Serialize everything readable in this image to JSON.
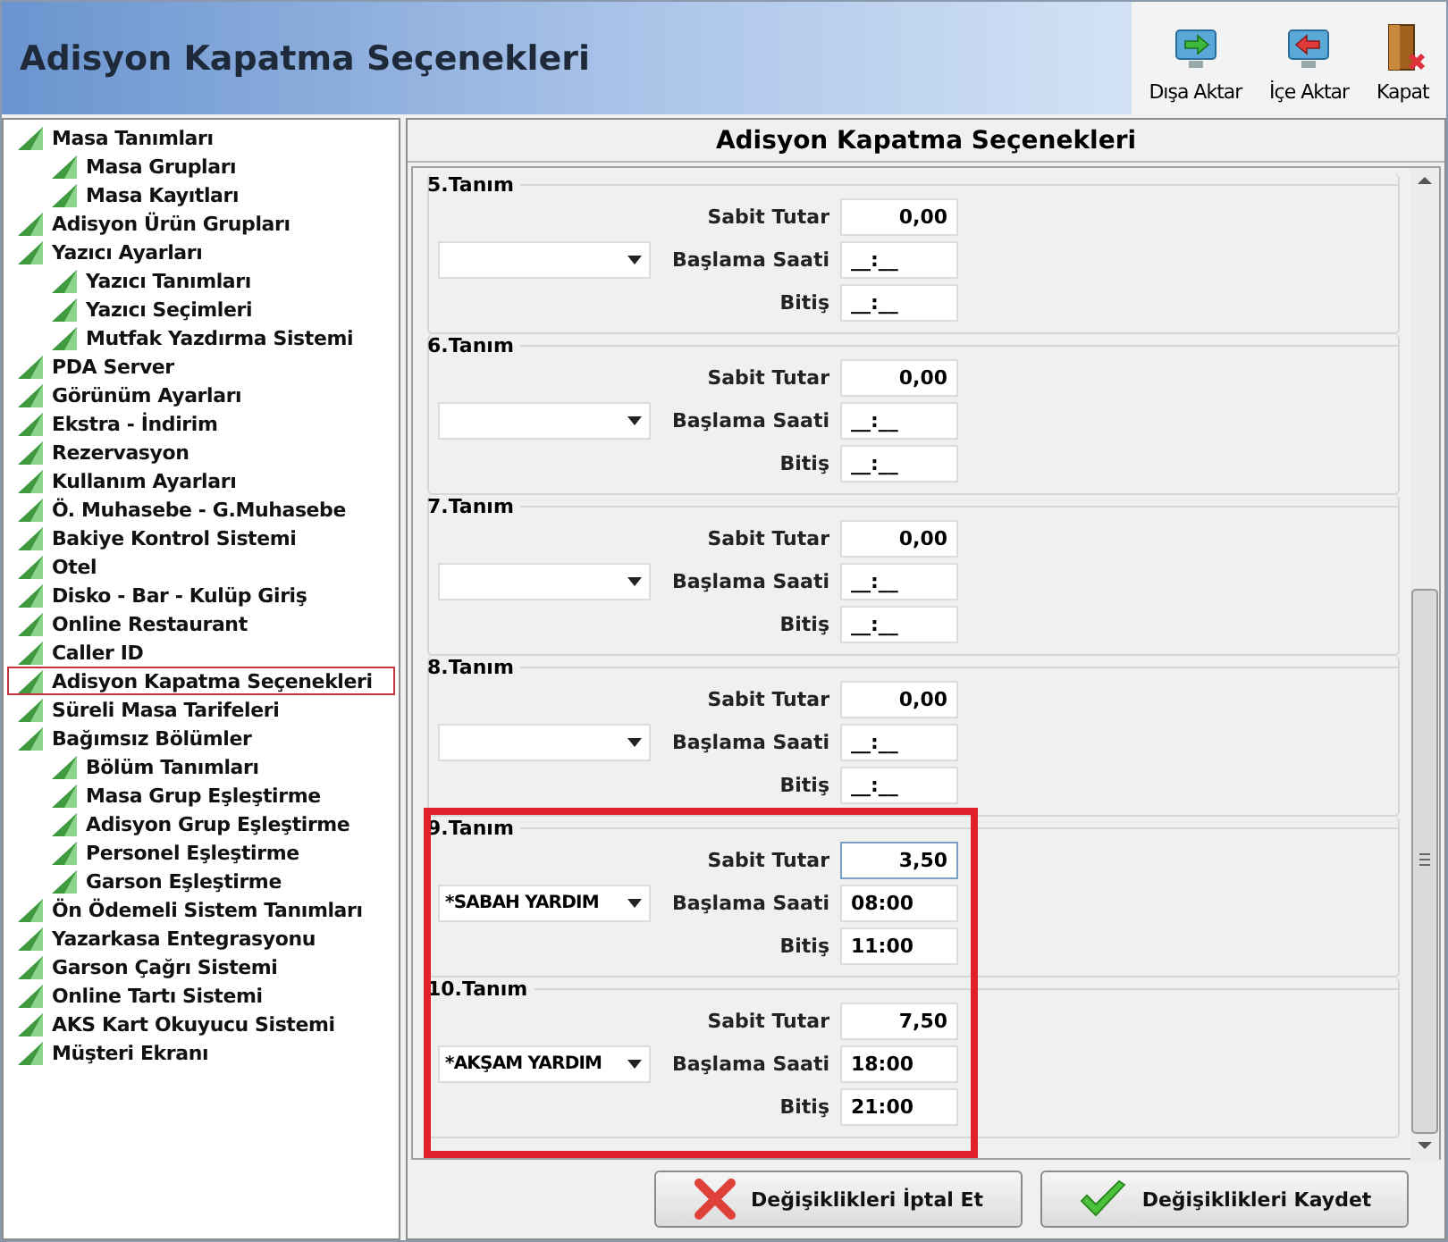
{
  "header": {
    "title": "Adisyon Kapatma Seçenekleri"
  },
  "toolbar": [
    {
      "kind": "export",
      "label": "Dışa Aktar"
    },
    {
      "kind": "import",
      "label": "İçe Aktar"
    },
    {
      "kind": "close",
      "label": "Kapat"
    }
  ],
  "sidebar": {
    "items": [
      {
        "label": "Masa Tanımları",
        "selected": false,
        "children": [
          {
            "label": "Masa Grupları",
            "selected": false
          },
          {
            "label": "Masa Kayıtları",
            "selected": false
          }
        ]
      },
      {
        "label": "Adisyon Ürün Grupları",
        "selected": false
      },
      {
        "label": "Yazıcı Ayarları",
        "selected": false,
        "children": [
          {
            "label": "Yazıcı Tanımları",
            "selected": false
          },
          {
            "label": "Yazıcı Seçimleri",
            "selected": false
          },
          {
            "label": "Mutfak Yazdırma Sistemi",
            "selected": false
          }
        ]
      },
      {
        "label": "PDA Server",
        "selected": false
      },
      {
        "label": "Görünüm Ayarları",
        "selected": false
      },
      {
        "label": "Ekstra - İndirim",
        "selected": false
      },
      {
        "label": "Rezervasyon",
        "selected": false
      },
      {
        "label": "Kullanım Ayarları",
        "selected": false
      },
      {
        "label": "Ö. Muhasebe - G.Muhasebe",
        "selected": false
      },
      {
        "label": "Bakiye Kontrol Sistemi",
        "selected": false
      },
      {
        "label": "Otel",
        "selected": false
      },
      {
        "label": "Disko - Bar - Kulüp Giriş",
        "selected": false
      },
      {
        "label": "Online Restaurant",
        "selected": false
      },
      {
        "label": "Caller ID",
        "selected": false
      },
      {
        "label": "Adisyon Kapatma Seçenekleri",
        "selected": true
      },
      {
        "label": "Süreli Masa Tarifeleri",
        "selected": false
      },
      {
        "label": "Bağımsız Bölümler",
        "selected": false,
        "children": [
          {
            "label": "Bölüm Tanımları",
            "selected": false
          },
          {
            "label": "Masa Grup Eşleştirme",
            "selected": false
          },
          {
            "label": "Adisyon Grup Eşleştirme",
            "selected": false
          },
          {
            "label": "Personel Eşleştirme",
            "selected": false
          },
          {
            "label": "Garson Eşleştirme",
            "selected": false
          }
        ]
      },
      {
        "label": "Ön Ödemeli Sistem Tanımları",
        "selected": false
      },
      {
        "label": "Yazarkasa Entegrasyonu",
        "selected": false
      },
      {
        "label": "Garson Çağrı Sistemi",
        "selected": false
      },
      {
        "label": "Online Tartı Sistemi",
        "selected": false
      },
      {
        "label": "AKS Kart Okuyucu Sistemi",
        "selected": false
      },
      {
        "label": "Müşteri Ekranı",
        "selected": false
      }
    ]
  },
  "panel": {
    "title": "Adisyon Kapatma Seçenekleri",
    "groups": [
      {
        "title": "5.Tanım",
        "highlighted": false,
        "amount_label": "Sabit Tutar",
        "amount": {
          "value": "0,00",
          "focused": false
        },
        "start_label": "Başlama Saati",
        "start": "__:__",
        "end_label": "Bitiş",
        "end": "__:__"
      },
      {
        "title": "6.Tanım",
        "highlighted": false,
        "amount_label": "Sabit Tutar",
        "amount": {
          "value": "0,00",
          "focused": false
        },
        "start_label": "Başlama Saati",
        "start": "__:__",
        "end_label": "Bitiş",
        "end": "__:__"
      },
      {
        "title": "7.Tanım",
        "highlighted": false,
        "amount_label": "Sabit Tutar",
        "amount": {
          "value": "0,00",
          "focused": false
        },
        "start_label": "Başlama Saati",
        "start": "__:__",
        "end_label": "Bitiş",
        "end": "__:__"
      },
      {
        "title": "8.Tanım",
        "highlighted": false,
        "amount_label": "Sabit Tutar",
        "amount": {
          "value": "0,00",
          "focused": false
        },
        "start_label": "Başlama Saati",
        "start": "__:__",
        "end_label": "Bitiş",
        "end": "__:__"
      },
      {
        "title": "9.Tanım",
        "highlighted": true,
        "combo": "*SABAH YARDIM",
        "amount_label": "Sabit Tutar",
        "amount": {
          "value": "3,50",
          "focused": true
        },
        "start_label": "Başlama Saati",
        "start": "08:00",
        "end_label": "Bitiş",
        "end": "11:00"
      },
      {
        "title": "10.Tanım",
        "highlighted": true,
        "combo": "*AKŞAM YARDIM",
        "amount_label": "Sabit Tutar",
        "amount": {
          "value": "7,50",
          "focused": false
        },
        "start_label": "Başlama Saati",
        "start": "18:00",
        "end_label": "Bitiş",
        "end": "21:00"
      }
    ]
  },
  "buttons": [
    {
      "kind": "cancel",
      "label": "Değişiklikleri İptal Et"
    },
    {
      "kind": "save",
      "label": "Değişiklikleri Kaydet"
    }
  ]
}
